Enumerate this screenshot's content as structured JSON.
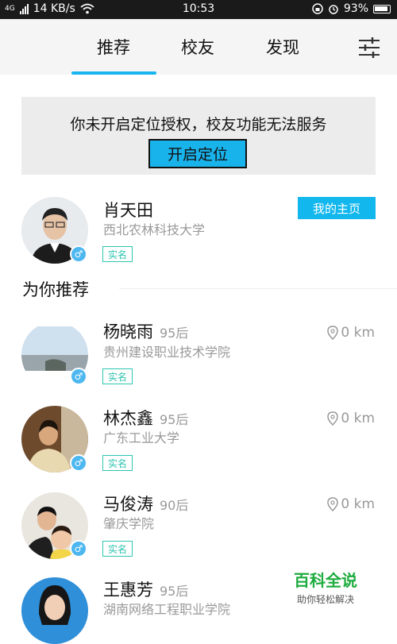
{
  "status_bar": {
    "network": "4G",
    "speed": "14 KB/s",
    "time": "10:53",
    "battery": "93%"
  },
  "top_nav": {
    "tabs": [
      "推荐",
      "校友",
      "发现"
    ],
    "active_tab": "推荐",
    "accent_color": "#18b5ee"
  },
  "location_banner": {
    "message": "你未开启定位授权，校友功能无法服务",
    "button_label": "开启定位"
  },
  "my_profile": {
    "name": "肖天田",
    "school": "西北农林科技大学",
    "badge": "实名",
    "gender": "male",
    "home_button": "我的主页"
  },
  "recommend_section": {
    "title": "为你推荐",
    "items": [
      {
        "name": "杨晓雨",
        "age": "95后",
        "school": "贵州建设职业技术学院",
        "badge": "实名",
        "distance": "0 km"
      },
      {
        "name": "林杰鑫",
        "age": "95后",
        "school": "广东工业大学",
        "badge": "实名",
        "distance": "0 km"
      },
      {
        "name": "马俊涛",
        "age": "90后",
        "school": "肇庆学院",
        "badge": "实名",
        "distance": "0 km"
      },
      {
        "name": "王惠芳",
        "age": "95后",
        "school": "湖南网络工程职业学院",
        "badge": "",
        "distance": ""
      }
    ]
  },
  "watermark": {
    "title": "百科全说",
    "subtitle": "助你轻松解决"
  }
}
